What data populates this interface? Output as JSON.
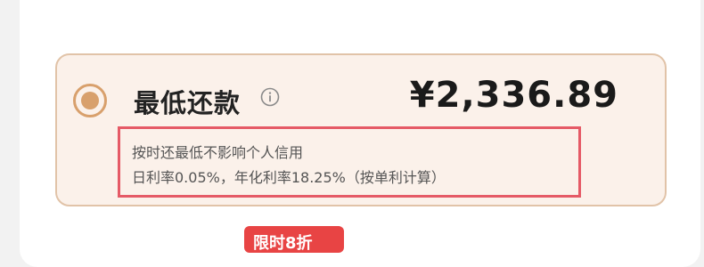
{
  "repayment_option": {
    "selected": true,
    "title": "最低还款",
    "info_icon": "info-circle-icon",
    "amount": "¥2,336.89",
    "description_line1": "按时还最低不影响个人信用",
    "description_line2": "日利率0.05%，年化利率18.25%（按单利计算）"
  },
  "promo_badge": {
    "text": "限时8折"
  },
  "colors": {
    "accent": "#d8a06c",
    "option_bg": "#fbf1ea",
    "option_border": "#e1c3a8",
    "highlight_border": "#e55a66",
    "badge_red": "#e84444"
  }
}
